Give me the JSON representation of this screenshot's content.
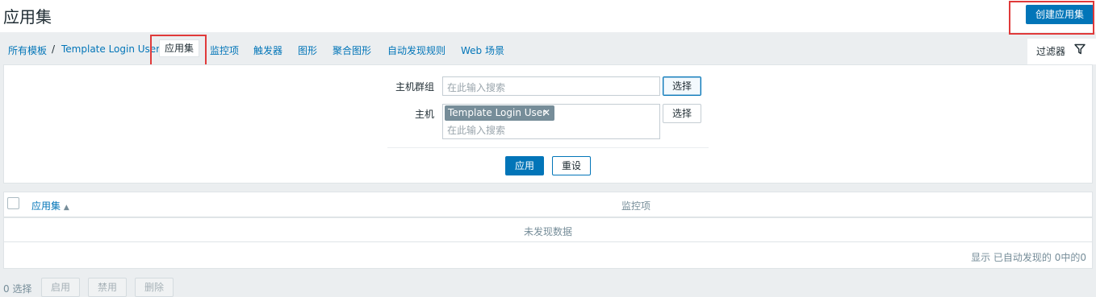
{
  "page": {
    "title": "应用集",
    "create_button": "创建应用集"
  },
  "nav": {
    "breadcrumb_root": "所有模板",
    "breadcrumb_sep": "/",
    "breadcrumb_host": "Template Login User",
    "tabs": [
      "应用集",
      "监控项",
      "触发器",
      "图形",
      "聚合图形",
      "自动发现规则",
      "Web 场景"
    ],
    "filter_tab": "过滤器"
  },
  "filter": {
    "host_group_label": "主机群组",
    "host_group_placeholder": "在此输入搜索",
    "select_label": "选择",
    "host_label": "主机",
    "host_tag": "Template Login User",
    "host_placeholder": "在此输入搜索",
    "apply": "应用",
    "reset": "重设"
  },
  "table": {
    "columns": [
      "应用集",
      "监控项"
    ],
    "sort_indicator": "▲",
    "empty": "未发现数据",
    "stats": "显示 已自动发现的 0中的0"
  },
  "footer": {
    "selected": "0 选择",
    "actions": [
      "启用",
      "禁用",
      "删除"
    ]
  },
  "colors": {
    "accent": "#0275b8",
    "highlight": "#e03a3a",
    "background": "#ebeef0"
  }
}
